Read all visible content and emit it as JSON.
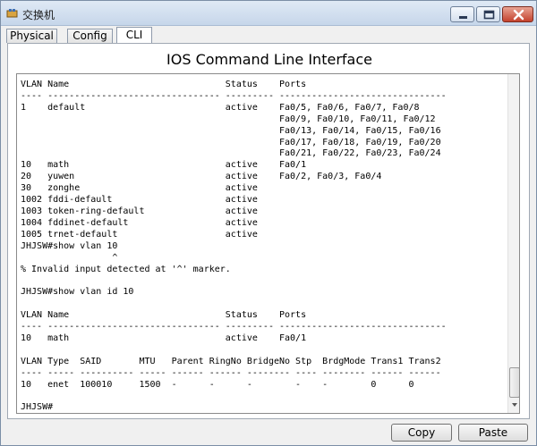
{
  "window": {
    "title": "交换机",
    "colors": {
      "titlebar": "#c6d6ea",
      "close": "#c4422d"
    }
  },
  "tabs": [
    {
      "label": "Physical"
    },
    {
      "label": "Config"
    },
    {
      "label": "CLI"
    }
  ],
  "cli": {
    "title": "IOS Command Line Interface",
    "lines": [
      "VLAN Name                             Status    Ports",
      "---- -------------------------------- --------- -------------------------------",
      "1    default                          active    Fa0/5, Fa0/6, Fa0/7, Fa0/8",
      "                                                Fa0/9, Fa0/10, Fa0/11, Fa0/12",
      "                                                Fa0/13, Fa0/14, Fa0/15, Fa0/16",
      "                                                Fa0/17, Fa0/18, Fa0/19, Fa0/20",
      "                                                Fa0/21, Fa0/22, Fa0/23, Fa0/24",
      "10   math                             active    Fa0/1",
      "20   yuwen                            active    Fa0/2, Fa0/3, Fa0/4",
      "30   zonghe                           active",
      "1002 fddi-default                     active",
      "1003 token-ring-default               active",
      "1004 fddinet-default                  active",
      "1005 trnet-default                    active",
      "JHJSW#show vlan 10",
      "                 ^",
      "% Invalid input detected at '^' marker.",
      "",
      "JHJSW#show vlan id 10",
      "",
      "VLAN Name                             Status    Ports",
      "---- -------------------------------- --------- -------------------------------",
      "10   math                             active    Fa0/1",
      "",
      "VLAN Type  SAID       MTU   Parent RingNo BridgeNo Stp  BrdgMode Trans1 Trans2",
      "---- ----- ---------- ----- ------ ------ -------- ---- -------- ------ ------",
      "10   enet  100010     1500  -      -      -        -    -        0      0",
      "",
      "JHJSW#"
    ]
  },
  "buttons": {
    "copy": "Copy",
    "paste": "Paste"
  }
}
